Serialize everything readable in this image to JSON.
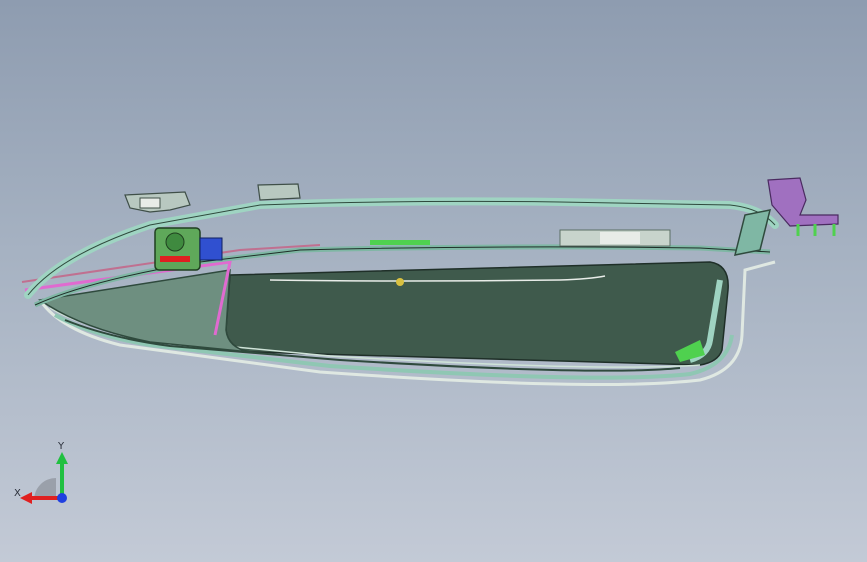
{
  "viewport": {
    "background_top": "#8e9cb0",
    "background_bottom": "#c3cad6"
  },
  "triad": {
    "x_label": "X",
    "y_label": "Y",
    "x_color": "#e02020",
    "y_color": "#20c040",
    "z_color": "#2040e0"
  },
  "model": {
    "body_color": "#3f5a4c",
    "frame_color": "#8fc7b3",
    "accent_pink": "#e06ad0",
    "accent_green": "#4fd14f",
    "accent_purple": "#a070c0"
  }
}
